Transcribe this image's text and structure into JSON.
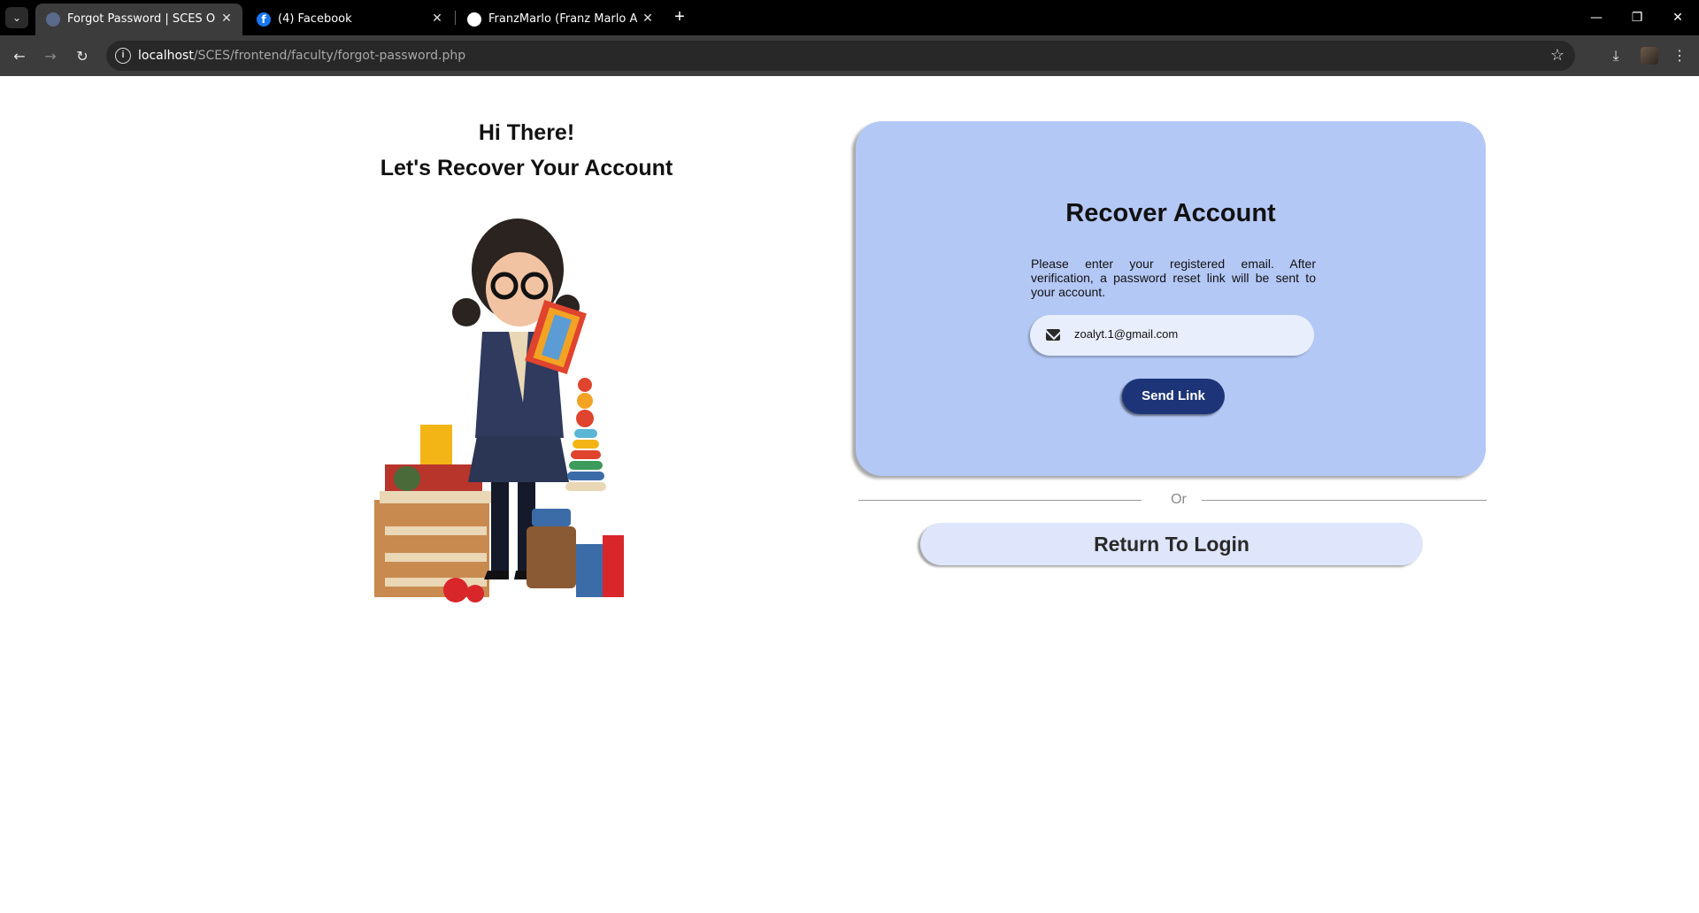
{
  "browser": {
    "tabs": [
      {
        "title": "Forgot Password | SCES Online",
        "favicon": "globe-icon",
        "active": true
      },
      {
        "title": "(4) Facebook",
        "favicon": "facebook-icon",
        "active": false
      },
      {
        "title": "FranzMarlo (Franz Marlo Andal)",
        "favicon": "github-icon",
        "active": false
      }
    ],
    "url_host": "localhost",
    "url_path": "/SCES/frontend/faculty/forgot-password.php"
  },
  "left": {
    "greeting": "Hi There!",
    "subtitle": "Let's Recover Your Account",
    "illustration": "teacher-with-books-illustration"
  },
  "card": {
    "title": "Recover Account",
    "description": "Please enter your registered email. After verification, a password reset link will be sent to your account.",
    "email_value": "zoalyt.1@gmail.com",
    "email_icon": "envelope-icon",
    "send_label": "Send Link"
  },
  "divider": {
    "label": "Or"
  },
  "return_label": "Return To Login",
  "colors": {
    "card_bg": "#b4c8f6",
    "send_button": "#1d3578",
    "return_button": "#dfe6fb"
  }
}
